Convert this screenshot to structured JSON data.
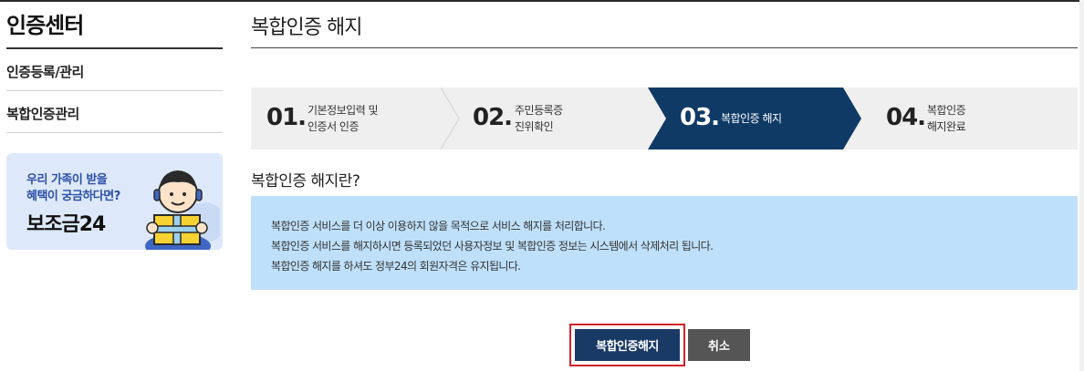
{
  "sidebar": {
    "title": "인증센터",
    "items": [
      {
        "label": "인증등록/관리"
      },
      {
        "label": "복합인증관리"
      }
    ],
    "banner": {
      "line1": "우리 가족이 받을",
      "line2": "혜택이 궁금하다면?",
      "brand": "보조금24"
    }
  },
  "main": {
    "title": "복합인증 해지",
    "steps": [
      {
        "num": "01.",
        "line1": "기본정보입력 및",
        "line2": "인증서 인증"
      },
      {
        "num": "02.",
        "line1": "주민등록증",
        "line2": "진위확인"
      },
      {
        "num": "03.",
        "line1": "복합인증 해지",
        "line2": ""
      },
      {
        "num": "04.",
        "line1": "복합인증",
        "line2": "해지완료"
      }
    ],
    "active_step": 3,
    "section_title": "복합인증 해지란?",
    "info": [
      "복합인증 서비스를 더 이상 이용하지 않을 목적으로 서비스 해지를 처리합니다.",
      "복합인증 서비스를 해지하시면 등록되었던 사용자정보 및 복합인증 정보는 시스템에서 삭제처리 됩니다.",
      "복합인증 해지를 하셔도 정부24의 회원자격은 유지됩니다."
    ],
    "buttons": {
      "confirm": "복합인증해지",
      "cancel": "취소"
    }
  },
  "colors": {
    "active_step": "#0f3a66",
    "info_bg": "#bfe0fb",
    "primary_button": "#1a3a66",
    "cancel_button": "#555555",
    "focus_outline": "#d0222a",
    "banner_bg": "#dde9fa"
  }
}
